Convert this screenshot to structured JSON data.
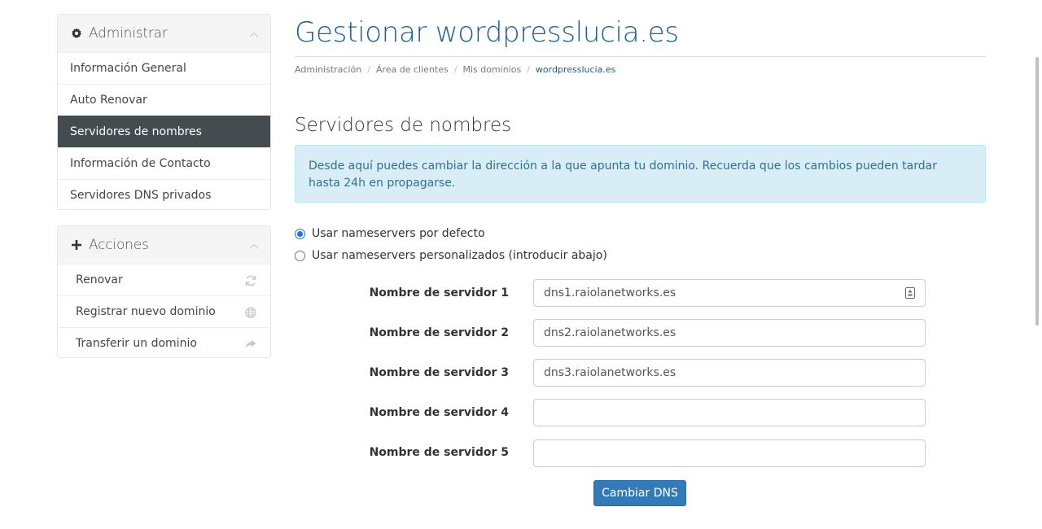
{
  "sidebar": {
    "admin": {
      "title": "Administrar",
      "items": [
        {
          "label": "Información General"
        },
        {
          "label": "Auto Renovar"
        },
        {
          "label": "Servidores de nombres",
          "active": true
        },
        {
          "label": "Información de Contacto"
        },
        {
          "label": "Servidores DNS privados"
        }
      ]
    },
    "actions": {
      "title": "Acciones",
      "items": [
        {
          "label": "Renovar",
          "icon": "refresh-icon"
        },
        {
          "label": "Registrar nuevo dominio",
          "icon": "globe-icon"
        },
        {
          "label": "Transferir un dominio",
          "icon": "share-arrow-icon"
        }
      ]
    }
  },
  "page": {
    "title": "Gestionar wordpresslucia.es",
    "breadcrumb": [
      "Administración",
      "Área de clientes",
      "Mis dominios",
      "wordpresslucia.es"
    ],
    "section_title": "Servidores de nombres",
    "alert": "Desde aquí puedes cambiar la dirección a la que apunta tu dominio. Recuerda que los cambios pueden tardar hasta 24h en propagarse."
  },
  "options": {
    "default": {
      "label": "Usar nameservers por defecto",
      "checked": true
    },
    "custom": {
      "label": "Usar nameservers personalizados (introducir abajo)",
      "checked": false
    }
  },
  "nameservers": [
    {
      "label": "Nombre de servidor 1",
      "value": "dns1.raiolanetworks.es"
    },
    {
      "label": "Nombre de servidor 2",
      "value": "dns2.raiolanetworks.es"
    },
    {
      "label": "Nombre de servidor 3",
      "value": "dns3.raiolanetworks.es"
    },
    {
      "label": "Nombre de servidor 4",
      "value": ""
    },
    {
      "label": "Nombre de servidor 5",
      "value": ""
    }
  ],
  "submit_label": "Cambiar DNS",
  "colors": {
    "accent": "#1f5f8b",
    "button": "#337ab7",
    "active_menu": "#444c4f",
    "alert_bg": "#d9edf7"
  }
}
